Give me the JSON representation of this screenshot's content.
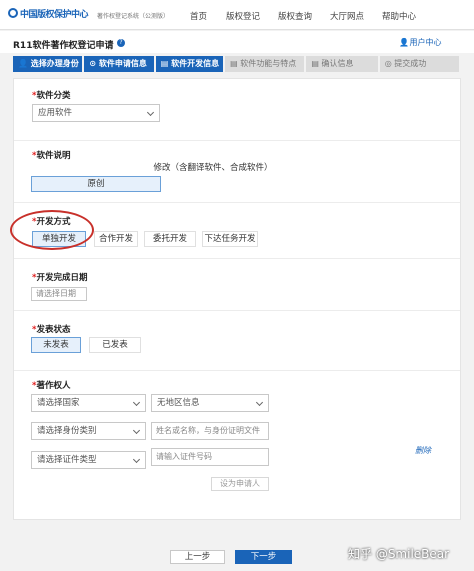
{
  "header": {
    "logo_text": "中国版权保护中心",
    "subtitle": "著作权登记系统（公测版）",
    "nav": [
      "首页",
      "版权登记",
      "版权查询",
      "大厅网点",
      "帮助中心"
    ]
  },
  "titlebar": {
    "title": "R11软件著作权登记申请",
    "help": "?",
    "user_center": "用户中心"
  },
  "steps": [
    {
      "label": "选择办理身份",
      "icon": "user-icon",
      "status": "done"
    },
    {
      "label": "软件申请信息",
      "icon": "info-icon",
      "status": "done"
    },
    {
      "label": "软件开发信息",
      "icon": "doc-icon",
      "status": "done"
    },
    {
      "label": "软件功能与特点",
      "icon": "list-icon",
      "status": "todo"
    },
    {
      "label": "确认信息",
      "icon": "check-icon",
      "status": "todo"
    },
    {
      "label": "提交成功",
      "icon": "submit-icon",
      "status": "todo"
    }
  ],
  "form": {
    "category": {
      "label": "软件分类",
      "value": "应用软件"
    },
    "description": {
      "label": "软件说明",
      "original": "原创",
      "modified": "修改（含翻译软件、合成软件）"
    },
    "dev_method": {
      "label": "开发方式",
      "options": [
        "单独开发",
        "合作开发",
        "委托开发",
        "下达任务开发"
      ],
      "selected": "单独开发"
    },
    "completion_date": {
      "label": "开发完成日期",
      "placeholder": "请选择日期"
    },
    "publish_status": {
      "label": "发表状态",
      "options": [
        "未发表",
        "已发表"
      ],
      "selected": "未发表"
    },
    "owner": {
      "label": "著作权人",
      "country_placeholder": "请选择国家",
      "region_placeholder": "无地区信息",
      "identity_placeholder": "请选择身份类别",
      "name_placeholder": "姓名或名称，与身份证明文件",
      "cert_type_placeholder": "请选择证件类型",
      "cert_no_placeholder": "请输入证件号码",
      "set_applicant": "设为申请人",
      "delete": "删除"
    }
  },
  "footer": {
    "prev": "上一步",
    "next": "下一步"
  },
  "watermark": "知乎 @SmileBear",
  "colors": {
    "accent": "#1a64b8",
    "annotation": "#c8302a"
  }
}
